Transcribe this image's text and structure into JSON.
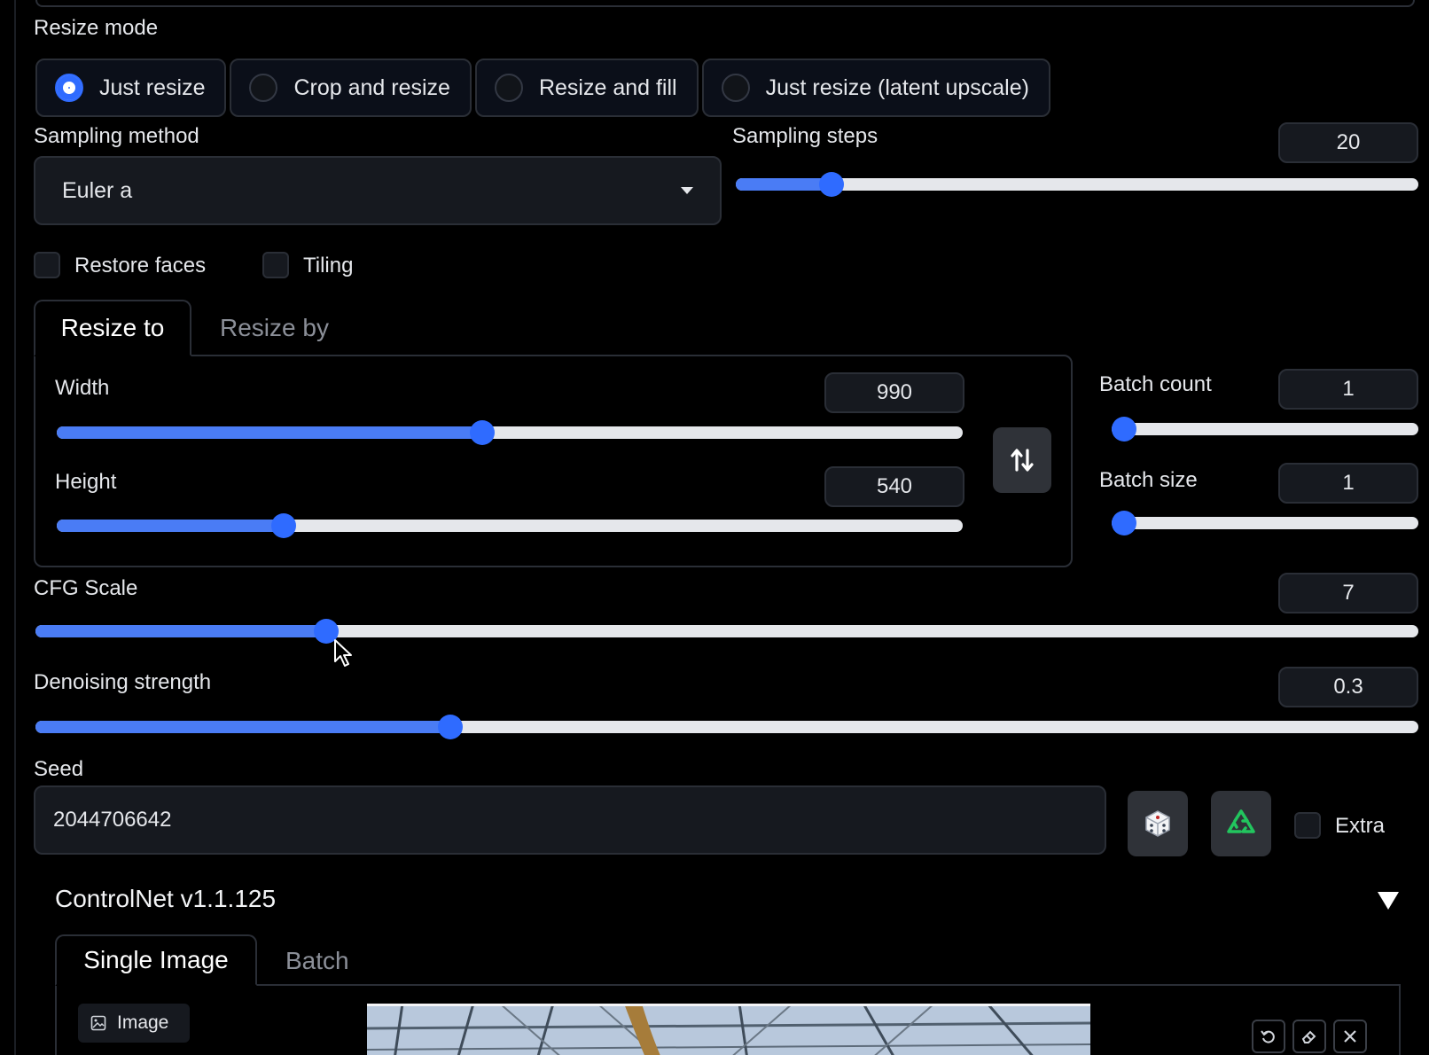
{
  "resize_mode": {
    "label": "Resize mode",
    "options": [
      "Just resize",
      "Crop and resize",
      "Resize and fill",
      "Just resize (latent upscale)"
    ],
    "selected": "Just resize"
  },
  "sampling_method": {
    "label": "Sampling method",
    "value": "Euler a"
  },
  "sampling_steps": {
    "label": "Sampling steps",
    "value": "20",
    "fraction": 0.14
  },
  "checkboxes": {
    "restore_faces": "Restore faces",
    "tiling": "Tiling"
  },
  "resize_tabs": {
    "active": "Resize to",
    "other": "Resize by"
  },
  "width": {
    "label": "Width",
    "value": "990",
    "fraction": 0.47
  },
  "height": {
    "label": "Height",
    "value": "540",
    "fraction": 0.25
  },
  "batch_count": {
    "label": "Batch count",
    "value": "1",
    "fraction": 0.0
  },
  "batch_size": {
    "label": "Batch size",
    "value": "1",
    "fraction": 0.0
  },
  "cfg_scale": {
    "label": "CFG Scale",
    "value": "7",
    "fraction": 0.21
  },
  "denoising": {
    "label": "Denoising strength",
    "value": "0.3",
    "fraction": 0.3
  },
  "seed": {
    "label": "Seed",
    "value": "2044706642",
    "extra_label": "Extra"
  },
  "controlnet": {
    "title": "ControlNet v1.1.125",
    "tabs": [
      "Single Image",
      "Batch"
    ],
    "image_label": "Image"
  },
  "icons": {
    "swap": "swap-vertical-icon",
    "dice": "dice-icon",
    "recycle": "recycle-icon",
    "collapse": "triangle-down-icon",
    "undo": "undo-icon",
    "erase": "eraser-icon",
    "close": "close-icon"
  },
  "colors": {
    "accent": "#2f6bff",
    "background": "#000000",
    "surface": "#16191f"
  }
}
